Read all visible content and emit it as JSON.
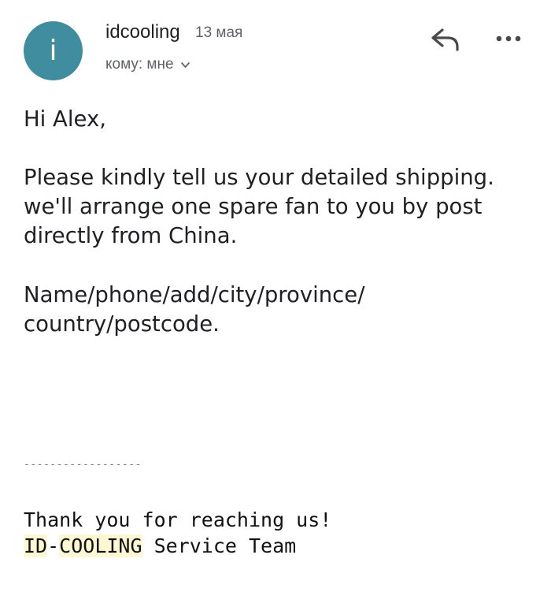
{
  "header": {
    "avatar_letter": "i",
    "avatar_color": "#3f8d9f",
    "sender": "idcooling",
    "date": "13 мая",
    "recipient": "кому: мне",
    "recipient_toggle_icon": "chevron-down-icon",
    "reply_icon": "reply-arrow-icon",
    "more_icon": "more-horizontal-icon"
  },
  "body": {
    "greeting": "Hi Alex,",
    "paragraph1": [
      "Please kindly tell us your detailed shipping.",
      "we'll arrange one spare fan to you by post",
      "directly from China."
    ],
    "paragraph2": [
      "Name/phone/add/city/province/",
      "country/postcode."
    ]
  },
  "signature": {
    "divider": "------------------",
    "line1": "Thank you for reaching us!",
    "brand_part1": "ID",
    "brand_dash": "-",
    "brand_part2": "COOLING",
    "team": " Service Team",
    "highlight_color": "#fdf8d3"
  }
}
